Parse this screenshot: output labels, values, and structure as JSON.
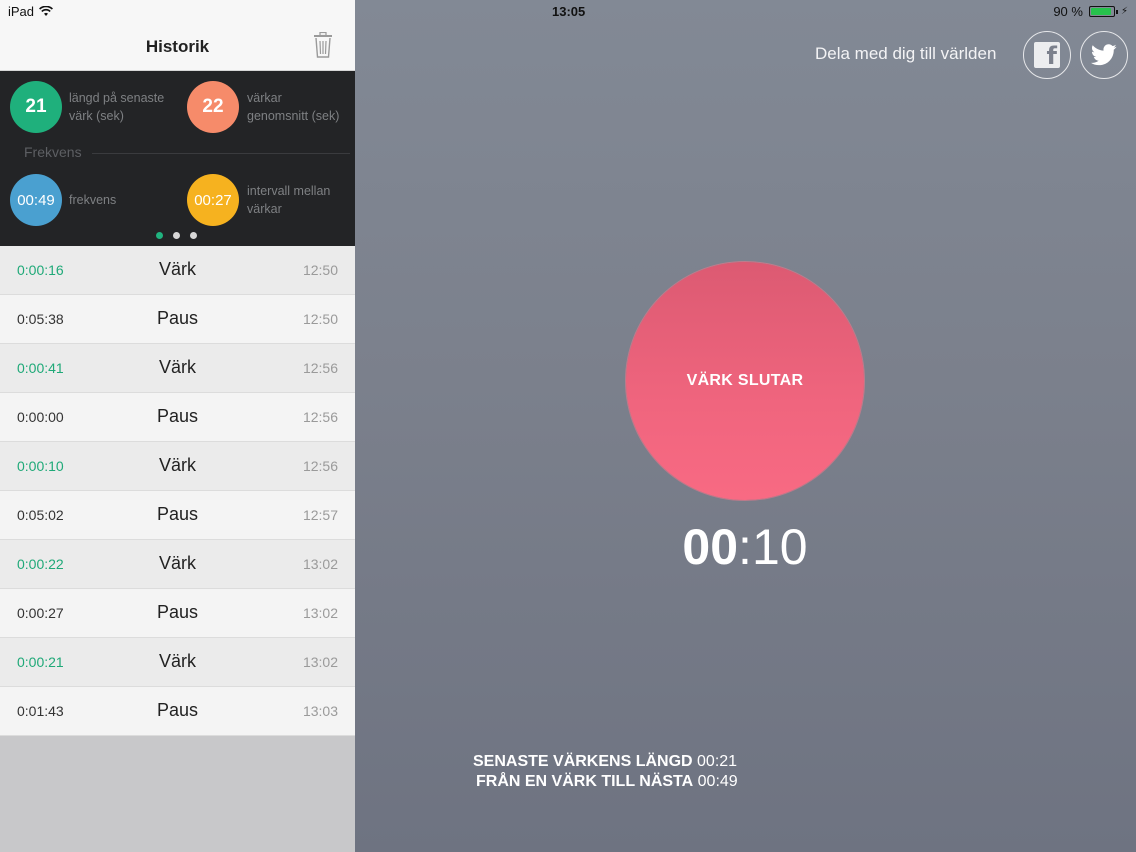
{
  "status_bar": {
    "device": "iPad",
    "time": "13:05",
    "battery": "90 %"
  },
  "sidebar": {
    "title": "Historik",
    "stats": [
      {
        "value": "21",
        "label_line1": "längd på senaste",
        "label_line2": "värk (sek)",
        "color": "#1fb07c"
      },
      {
        "value": "22",
        "label_line1": "värkar",
        "label_line2": "genomsnitt (sek)",
        "color": "#f68b6a"
      }
    ],
    "section_label": "Frekvens",
    "freq": [
      {
        "value": "00:49",
        "label_line1": "frekvens",
        "label_line2": "",
        "color": "#4aa0d0"
      },
      {
        "value": "00:27",
        "label_line1": "intervall mellan",
        "label_line2": "värkar",
        "color": "#f6b21f"
      }
    ],
    "page_dots": 3,
    "rows": [
      {
        "duration": "0:00:16",
        "type": "Värk",
        "time": "12:50",
        "kind": "pain"
      },
      {
        "duration": "0:05:38",
        "type": "Paus",
        "time": "12:50",
        "kind": "pause"
      },
      {
        "duration": "0:00:41",
        "type": "Värk",
        "time": "12:56",
        "kind": "pain"
      },
      {
        "duration": "0:00:00",
        "type": "Paus",
        "time": "12:56",
        "kind": "pause"
      },
      {
        "duration": "0:00:10",
        "type": "Värk",
        "time": "12:56",
        "kind": "pain"
      },
      {
        "duration": "0:05:02",
        "type": "Paus",
        "time": "12:57",
        "kind": "pause"
      },
      {
        "duration": "0:00:22",
        "type": "Värk",
        "time": "13:02",
        "kind": "pain"
      },
      {
        "duration": "0:00:27",
        "type": "Paus",
        "time": "13:02",
        "kind": "pause"
      },
      {
        "duration": "0:00:21",
        "type": "Värk",
        "time": "13:02",
        "kind": "pain"
      },
      {
        "duration": "0:01:43",
        "type": "Paus",
        "time": "13:03",
        "kind": "pause"
      }
    ]
  },
  "main": {
    "share_text": "Dela med dig till världen",
    "action_button": "VÄRK SLUTAR",
    "timer_minutes": "00",
    "timer_sep": ":",
    "timer_seconds": "10",
    "last_length_label": "SENASTE VÄRKENS LÄNGD",
    "last_length_value": "00:21",
    "interval_label": "FRÅN EN VÄRK TILL NÄSTA",
    "interval_value": "00:49"
  },
  "colors": {
    "pain_text": "#1fa978",
    "button": "#f0657e",
    "accent": "#20b37f"
  }
}
